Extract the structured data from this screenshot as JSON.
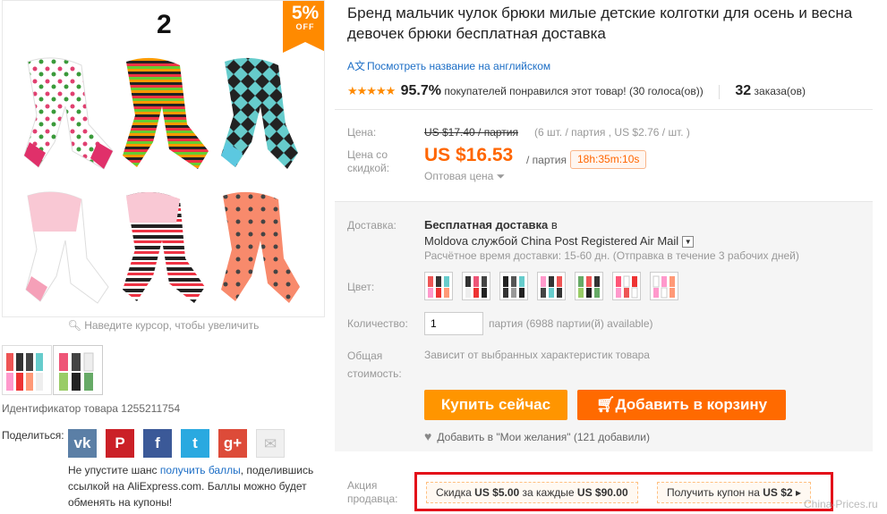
{
  "gallery": {
    "number": "2",
    "badge_pct": "5%",
    "badge_off": "OFF",
    "zoom_hint": "Наведите курсор, чтобы увеличить",
    "product_id": "Идентификатор товара 1255211754"
  },
  "share": {
    "label": "Поделиться:",
    "networks": [
      "vk",
      "pinterest",
      "facebook",
      "twitter",
      "google-plus",
      "email"
    ],
    "points_pre": "Не упустите шанс ",
    "points_link": "получить баллы",
    "points_post": ", поделившись ссылкой на AliExpress.com. Баллы можно будет обменять на купоны!"
  },
  "product": {
    "title": "Бренд мальчик чулок брюки милые детские колготки для осень и весна девочек брюки бесплатная доставка",
    "translate_icon": "A文",
    "translate_link": "Посмотреть название на английском",
    "stars": "★★★★★",
    "score": "95.7%",
    "score_text": "покупателей понравился этот товар! (30 голоса(ов))",
    "orders_num": "32",
    "orders_text": "заказа(ов)"
  },
  "price": {
    "label": "Цена:",
    "old": "US $17.40 / партия",
    "old_meta": "(6 шт. / партия , US $2.76 / шт. )",
    "discount_label_1": "Цена со",
    "discount_label_2": "скидкой:",
    "new": "US $16.53",
    "per": "/ партия",
    "timer": "18h:35m:10s",
    "wholesale": "Оптовая цена ⏷"
  },
  "shipping": {
    "label": "Доставка:",
    "free": "Бесплатная доставка",
    "to": " в",
    "line2": "Moldova службой China Post Registered Air Mail",
    "eta": "Расчётное время доставки: 15-60 дн. (Отправка в течение 3 рабочих дней)"
  },
  "color": {
    "label": "Цвет:",
    "swatches": 7
  },
  "quantity": {
    "label": "Количество:",
    "value": "1",
    "meta": "партия (6988 партии(й) available)"
  },
  "total": {
    "label_1": "Общая",
    "label_2": "стоимость:",
    "meta": "Зависит от выбранных характеристик товара"
  },
  "actions": {
    "buy": "Купить сейчас",
    "cart": "Добавить в корзину",
    "wish": "Добавить в \"Мои желания\" (121 добавили)"
  },
  "promo": {
    "label_1": "Акция",
    "label_2": "продавца:",
    "c1_pre": "Скидка ",
    "c1_amt": "US $5.00",
    "c1_mid": " за каждые ",
    "c1_thr": "US $90.00",
    "c2_pre": "Получить купон на ",
    "c2_amt": "US $2",
    "c2_arrow": "▸"
  },
  "watermark": "China-Prices.ru",
  "colors": {
    "accent": "#ff6a00",
    "buy": "#ff9500",
    "link": "#1c6ec6",
    "promo_border": "#e3101a"
  }
}
